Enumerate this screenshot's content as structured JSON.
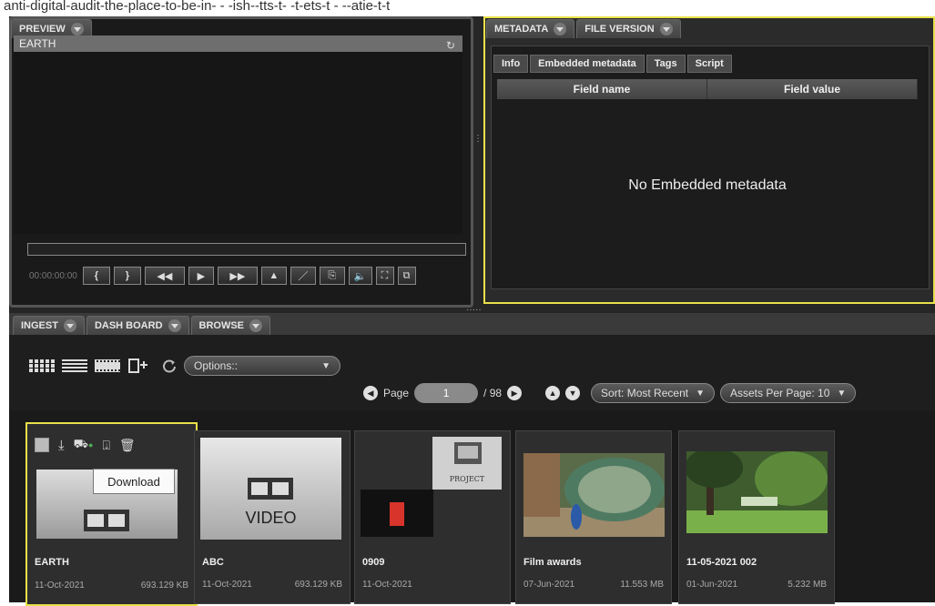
{
  "top_text": "anti-digital-audit-the-place-to-be-in- -    -ish--tts-t- -t-ets-t - --atie-t-t",
  "preview": {
    "tab_label": "PREVIEW",
    "clip_title": "EARTH",
    "refresh_icon": "refresh-icon",
    "timecode": "00:00:00:00",
    "controls": [
      "{",
      "}",
      "◂◂",
      "▸",
      "▸▸",
      "∧",
      "/",
      "⧉",
      "🔊",
      "⛶",
      "⧉"
    ]
  },
  "metadata": {
    "tabs": [
      "METADATA",
      "FILE VERSION"
    ],
    "subtabs": [
      "Info",
      "Embedded metadata",
      "Tags",
      "Script"
    ],
    "columns": [
      "Field name",
      "Field value"
    ],
    "empty_text": "No Embedded metadata"
  },
  "lower_tabs": [
    "INGEST",
    "DASH BOARD",
    "BROWSE"
  ],
  "browse": {
    "options_label": "Options::",
    "page_label": "Page",
    "page_current": "1",
    "page_total": "/ 98",
    "sort_label": "Sort: Most Recent",
    "assets_label": "Assets Per Page: 10"
  },
  "tooltip": "Download",
  "cards": [
    {
      "name": "EARTH",
      "date": "11-Oct-2021",
      "size": "693.129 KB",
      "kind": "video-gray",
      "selected": true
    },
    {
      "name": "ABC",
      "date": "11-Oct-2021",
      "size": "693.129 KB",
      "kind": "video-label",
      "thumb_text": "VIDEO"
    },
    {
      "name": "0909",
      "date": "11-Oct-2021",
      "size": "",
      "kind": "project",
      "thumb_text": "PROJECT"
    },
    {
      "name": "Film awards",
      "date": "07-Jun-2021",
      "size": "11.553 MB",
      "kind": "photo-peacock"
    },
    {
      "name": "11-05-2021 002",
      "date": "01-Jun-2021",
      "size": "5.232 MB",
      "kind": "photo-trees"
    }
  ],
  "colors": {
    "highlight": "#e8e04a",
    "panel_bg": "#262626"
  }
}
